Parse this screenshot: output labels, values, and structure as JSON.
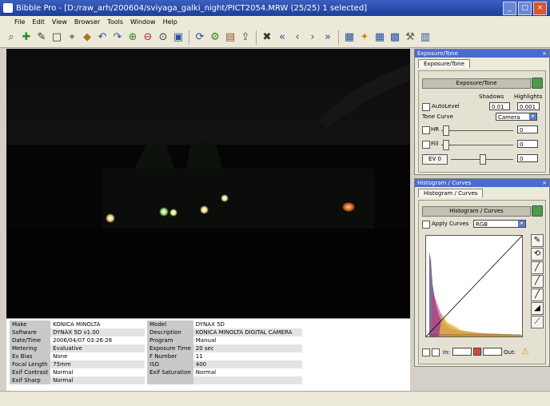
{
  "window": {
    "title": "Bibble Pro - [D:/raw_arh/200604/sviyaga_galki_night/PICT2054.MRW (25/25) 1 selected]"
  },
  "menu": [
    "File",
    "Edit",
    "View",
    "Browser",
    "Tools",
    "Window",
    "Help"
  ],
  "toolbar_icons": [
    "zoom-in-icon",
    "add-icon",
    "pen-icon",
    "crop-icon",
    "zoom-tool-icon",
    "color-icon",
    "rotate-left-icon",
    "rotate-right-icon",
    "zoom-in-2-icon",
    "zoom-out-icon",
    "zoom-fit-icon",
    "fit-window-icon",
    "refresh-icon",
    "settings-icon",
    "batch-icon",
    "export-icon",
    "delete-icon",
    "first-icon",
    "prev-icon",
    "next-icon",
    "last-icon",
    "layout-icon",
    "tag-icon",
    "grid-icon",
    "folder-icon",
    "tools-icon",
    "stack-icon"
  ],
  "metadata": {
    "col1": [
      {
        "label": "Make",
        "value": "KONICA MINOLTA"
      },
      {
        "label": "Software",
        "value": "DYNAX 5D v1.00"
      },
      {
        "label": "Date/Time",
        "value": "2006/04/07 03:26:28"
      },
      {
        "label": "Metering",
        "value": "Evaluative"
      },
      {
        "label": "Ev Bias",
        "value": "None"
      },
      {
        "label": "Focal Length",
        "value": "75mm"
      },
      {
        "label": "Exif Contrast",
        "value": "Normal"
      },
      {
        "label": "Exif Sharp",
        "value": "Normal"
      }
    ],
    "col2": [
      {
        "label": "Model",
        "value": "DYNAX 5D"
      },
      {
        "label": "Description",
        "value": "KONICA MINOLTA DIGITAL CAMERA"
      },
      {
        "label": "Program",
        "value": "Manual"
      },
      {
        "label": "Exposure Time",
        "value": "20 sec"
      },
      {
        "label": "F Number",
        "value": "11"
      },
      {
        "label": "ISO",
        "value": "400"
      },
      {
        "label": "Exif Saturation",
        "value": "Normal"
      },
      {
        "label": "",
        "value": ""
      }
    ]
  },
  "exposure_panel": {
    "window_title": "Exposure/Tone",
    "tab": "Exposure/Tone",
    "section": "Exposure/Tone",
    "shadows_label": "Shadows",
    "highlights_label": "Highlights",
    "autolevel_label": "AutoLevel",
    "shadows_value": "0.01",
    "highlights_value": "0.001",
    "tone_curve_label": "Tone Curve",
    "tone_curve_value": "Camera",
    "hr_label": "HR",
    "hr_value": "0",
    "fill_label": "Fill",
    "fill_value": "0",
    "ev_label": "EV 0",
    "ev_value": "0"
  },
  "histogram_panel": {
    "window_title": "Histogram / Curves",
    "tab": "Histogram / Curves",
    "section": "Histogram / Curves",
    "apply_label": "Apply Curves",
    "channel_value": "RGB",
    "in_label": "In:",
    "out_label": "Out:"
  }
}
